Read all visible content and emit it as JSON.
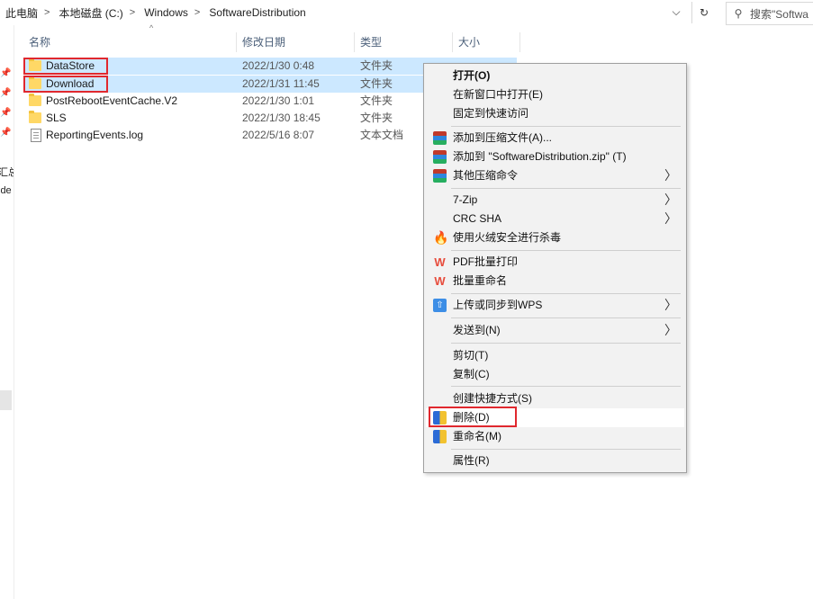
{
  "address": {
    "crumbs": [
      "此电脑",
      "本地磁盘 (C:)",
      "Windows",
      "SoftwareDistribution"
    ],
    "separator": ">",
    "search_placeholder": "搜索\"Softwa"
  },
  "nav": {
    "texts": [
      "汇总",
      "ide"
    ]
  },
  "columns": {
    "name": "名称",
    "date": "修改日期",
    "type": "类型",
    "size": "大小"
  },
  "files": [
    {
      "name": "DataStore",
      "date": "2022/1/30 0:48",
      "type": "文件夹",
      "kind": "folder",
      "selected": true
    },
    {
      "name": "Download",
      "date": "2022/1/31 11:45",
      "type": "文件夹",
      "kind": "folder",
      "selected": true
    },
    {
      "name": "PostRebootEventCache.V2",
      "date": "2022/1/30 1:01",
      "type": "文件夹",
      "kind": "folder",
      "selected": false
    },
    {
      "name": "SLS",
      "date": "2022/1/30 18:45",
      "type": "文件夹",
      "kind": "folder",
      "selected": false
    },
    {
      "name": "ReportingEvents.log",
      "date": "2022/5/16 8:07",
      "type": "文本文档",
      "kind": "document",
      "selected": false
    }
  ],
  "context_menu": {
    "open": "打开(O)",
    "open_new_window": "在新窗口中打开(E)",
    "pin_quick_access": "固定到快速访问",
    "add_to_archive": "添加到压缩文件(A)...",
    "add_to_zip": "添加到 \"SoftwareDistribution.zip\" (T)",
    "other_compress": "其他压缩命令",
    "sevenzip": "7-Zip",
    "crc_sha": "CRC SHA",
    "huorong_scan": "使用火绒安全进行杀毒",
    "pdf_print": "PDF批量打印",
    "batch_rename": "批量重命名",
    "upload_wps": "上传或同步到WPS",
    "send_to": "发送到(N)",
    "cut": "剪切(T)",
    "copy": "复制(C)",
    "create_shortcut": "创建快捷方式(S)",
    "delete": "删除(D)",
    "rename": "重命名(M)",
    "properties": "属性(R)"
  },
  "glyphs": {
    "dropdown": "⌵",
    "refresh": "↻",
    "search": "⚲",
    "pin": "📌",
    "sort_up": "^",
    "submenu": "〉",
    "fire": "🔥",
    "wps": "W",
    "cloud": "⇧"
  }
}
